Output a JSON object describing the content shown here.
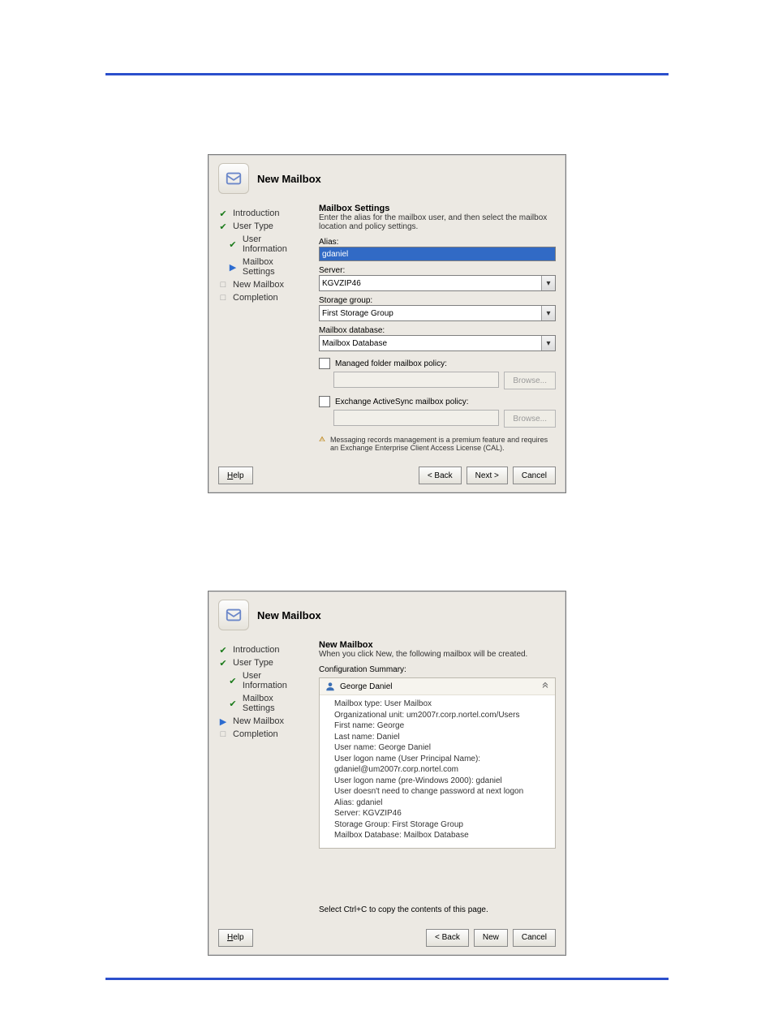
{
  "wizard_title": "New Mailbox",
  "steps": {
    "introduction": "Introduction",
    "user_type": "User Type",
    "user_information": "User Information",
    "mailbox_settings": "Mailbox Settings",
    "new_mailbox": "New Mailbox",
    "completion": "Completion"
  },
  "fig1": {
    "heading": "Mailbox Settings",
    "sub": "Enter the alias for the mailbox user, and then select the mailbox location and policy settings.",
    "alias_label": "Alias:",
    "alias_value": "gdaniel",
    "server_label": "Server:",
    "server_value": "KGVZIP46",
    "storage_group_label": "Storage group:",
    "storage_group_value": "First Storage Group",
    "mailbox_db_label": "Mailbox database:",
    "mailbox_db_value": "Mailbox Database",
    "managed_policy_label": "Managed folder mailbox policy:",
    "activesync_policy_label": "Exchange ActiveSync mailbox policy:",
    "browse": "Browse...",
    "note": "Messaging records management is a premium feature and requires an Exchange Enterprise Client Access License (CAL).",
    "help": "Help",
    "back": "< Back",
    "next": "Next >",
    "cancel": "Cancel"
  },
  "fig2": {
    "heading": "New Mailbox",
    "sub": "When you click New, the following mailbox will be created.",
    "config_summary_label": "Configuration Summary:",
    "user_display": "George Daniel",
    "lines": {
      "l1": "Mailbox type: User Mailbox",
      "l2": "Organizational unit: um2007r.corp.nortel.com/Users",
      "l3": "First name: George",
      "l4": "Last name: Daniel",
      "l5": "User name: George Daniel",
      "l6": "User logon name (User Principal Name): gdaniel@um2007r.corp.nortel.com",
      "l7": "User logon name (pre-Windows 2000): gdaniel",
      "l8": "User doesn't need to change password at next logon",
      "l9": "Alias: gdaniel",
      "l10": "Server: KGVZIP46",
      "l11": "Storage Group: First Storage Group",
      "l12": "Mailbox Database: Mailbox Database"
    },
    "copy_hint": "Select Ctrl+C to copy the contents of this page.",
    "help": "Help",
    "back": "< Back",
    "new": "New",
    "cancel": "Cancel"
  }
}
